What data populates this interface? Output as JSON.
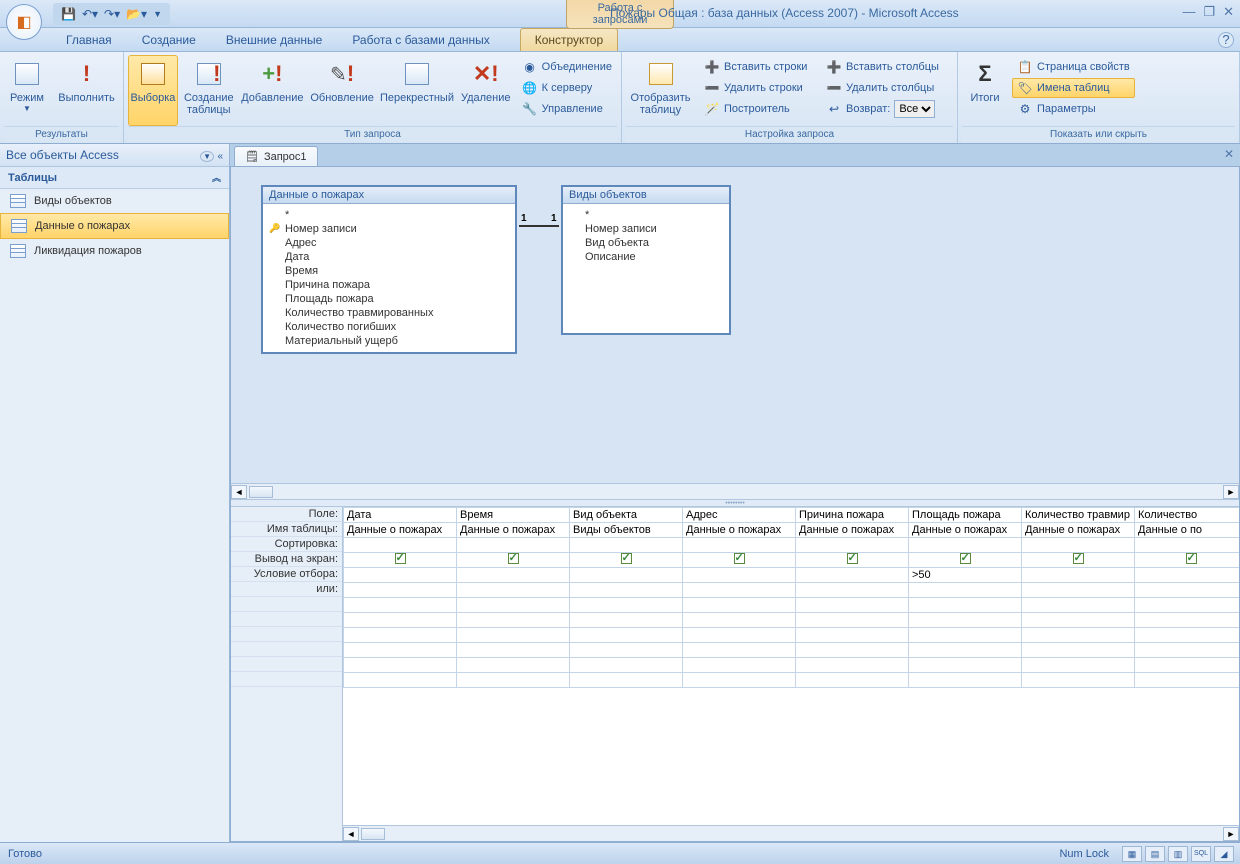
{
  "title_context": "Работа с запросами",
  "window_title": "Пожары Общая : база данных (Access 2007) - Microsoft Access",
  "tabs": [
    "Главная",
    "Создание",
    "Внешние данные",
    "Работа с базами данных"
  ],
  "context_tab": "Конструктор",
  "ribbon": {
    "results": {
      "label": "Результаты",
      "mode": "Режим",
      "run": "Выполнить"
    },
    "qtype": {
      "label": "Тип запроса",
      "select": "Выборка",
      "maketable": "Создание\nтаблицы",
      "append": "Добавление",
      "update": "Обновление",
      "crosstab": "Перекрестный",
      "delete": "Удаление",
      "union": "Объединение",
      "passthrough": "К серверу",
      "datadef": "Управление"
    },
    "show": {
      "label": "",
      "showtbl": "Отобразить\nтаблицу"
    },
    "setup": {
      "label": "Настройка запроса",
      "insrows": "Вставить строки",
      "delrows": "Удалить строки",
      "builder": "Построитель",
      "inscols": "Вставить столбцы",
      "delcols": "Удалить столбцы",
      "return": "Возврат:",
      "return_val": "Все"
    },
    "totals": {
      "totals": "Итоги"
    },
    "showhide": {
      "label": "Показать или скрыть",
      "propsheet": "Страница свойств",
      "tablenames": "Имена таблиц",
      "params": "Параметры"
    }
  },
  "nav": {
    "header": "Все объекты Access",
    "group": "Таблицы",
    "items": [
      "Виды объектов",
      "Данные о пожарах",
      "Ликвидация пожаров"
    ],
    "selected": 1
  },
  "doc_tab": "Запрос1",
  "table1": {
    "title": "Данные о пожарах",
    "fields": [
      "*",
      "Номер записи",
      "Адрес",
      "Дата",
      "Время",
      "Причина пожара",
      "Площадь пожара",
      "Количество травмированных",
      "Количество погибших",
      "Материальный ущерб"
    ],
    "key_index": 1
  },
  "table2": {
    "title": "Виды объектов",
    "fields": [
      "*",
      "Номер записи",
      "Вид объекта",
      "Описание"
    ]
  },
  "rel": {
    "left": "1",
    "right": "1"
  },
  "grid": {
    "row_labels": [
      "Поле:",
      "Имя таблицы:",
      "Сортировка:",
      "Вывод на экран:",
      "Условие отбора:",
      "или:"
    ],
    "cols": [
      {
        "field": "Дата",
        "table": "Данные о пожарах",
        "show": true,
        "crit": ""
      },
      {
        "field": "Время",
        "table": "Данные о пожарах",
        "show": true,
        "crit": ""
      },
      {
        "field": "Вид объекта",
        "table": "Виды объектов",
        "show": true,
        "crit": ""
      },
      {
        "field": "Адрес",
        "table": "Данные о пожарах",
        "show": true,
        "crit": ""
      },
      {
        "field": "Причина пожара",
        "table": "Данные о пожарах",
        "show": true,
        "crit": ""
      },
      {
        "field": "Площадь пожара",
        "table": "Данные о пожарах",
        "show": true,
        "crit": ">50"
      },
      {
        "field": "Количество травмир",
        "table": "Данные о пожарах",
        "show": true,
        "crit": ""
      },
      {
        "field": "Количество",
        "table": "Данные о по",
        "show": true,
        "crit": ""
      }
    ]
  },
  "status": {
    "ready": "Готово",
    "numlock": "Num Lock"
  }
}
